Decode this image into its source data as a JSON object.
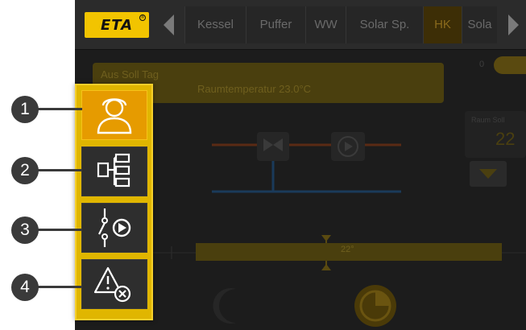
{
  "brand": {
    "logo_text": "ETA",
    "logo_mark": "®"
  },
  "tabs": [
    {
      "label": "Kessel",
      "active": false
    },
    {
      "label": "Puffer",
      "active": false
    },
    {
      "label": "WW",
      "active": false
    },
    {
      "label": "Solar Sp.",
      "active": false
    },
    {
      "label": "HK",
      "active": true
    },
    {
      "label": "Sola",
      "active": false
    }
  ],
  "info": {
    "line1": "Aus Soll Tag",
    "line2": "Raumtemperatur 23.0°C"
  },
  "toggle": {
    "label": "0"
  },
  "room_card": {
    "label": "Raum Soll",
    "value": "22"
  },
  "slider": {
    "value": "22°"
  },
  "side_menu": {
    "items": [
      {
        "number": "1",
        "icon": "user-icon",
        "selected": true
      },
      {
        "number": "2",
        "icon": "hierarchy-icon",
        "selected": false
      },
      {
        "number": "3",
        "icon": "switch-play-icon",
        "selected": false
      },
      {
        "number": "4",
        "icon": "warning-cancel-icon",
        "selected": false
      }
    ]
  },
  "colors": {
    "accent": "#e0b600",
    "selected": "#e69b00",
    "callout": "#3a3a3a",
    "background": "#1c1c1c"
  }
}
